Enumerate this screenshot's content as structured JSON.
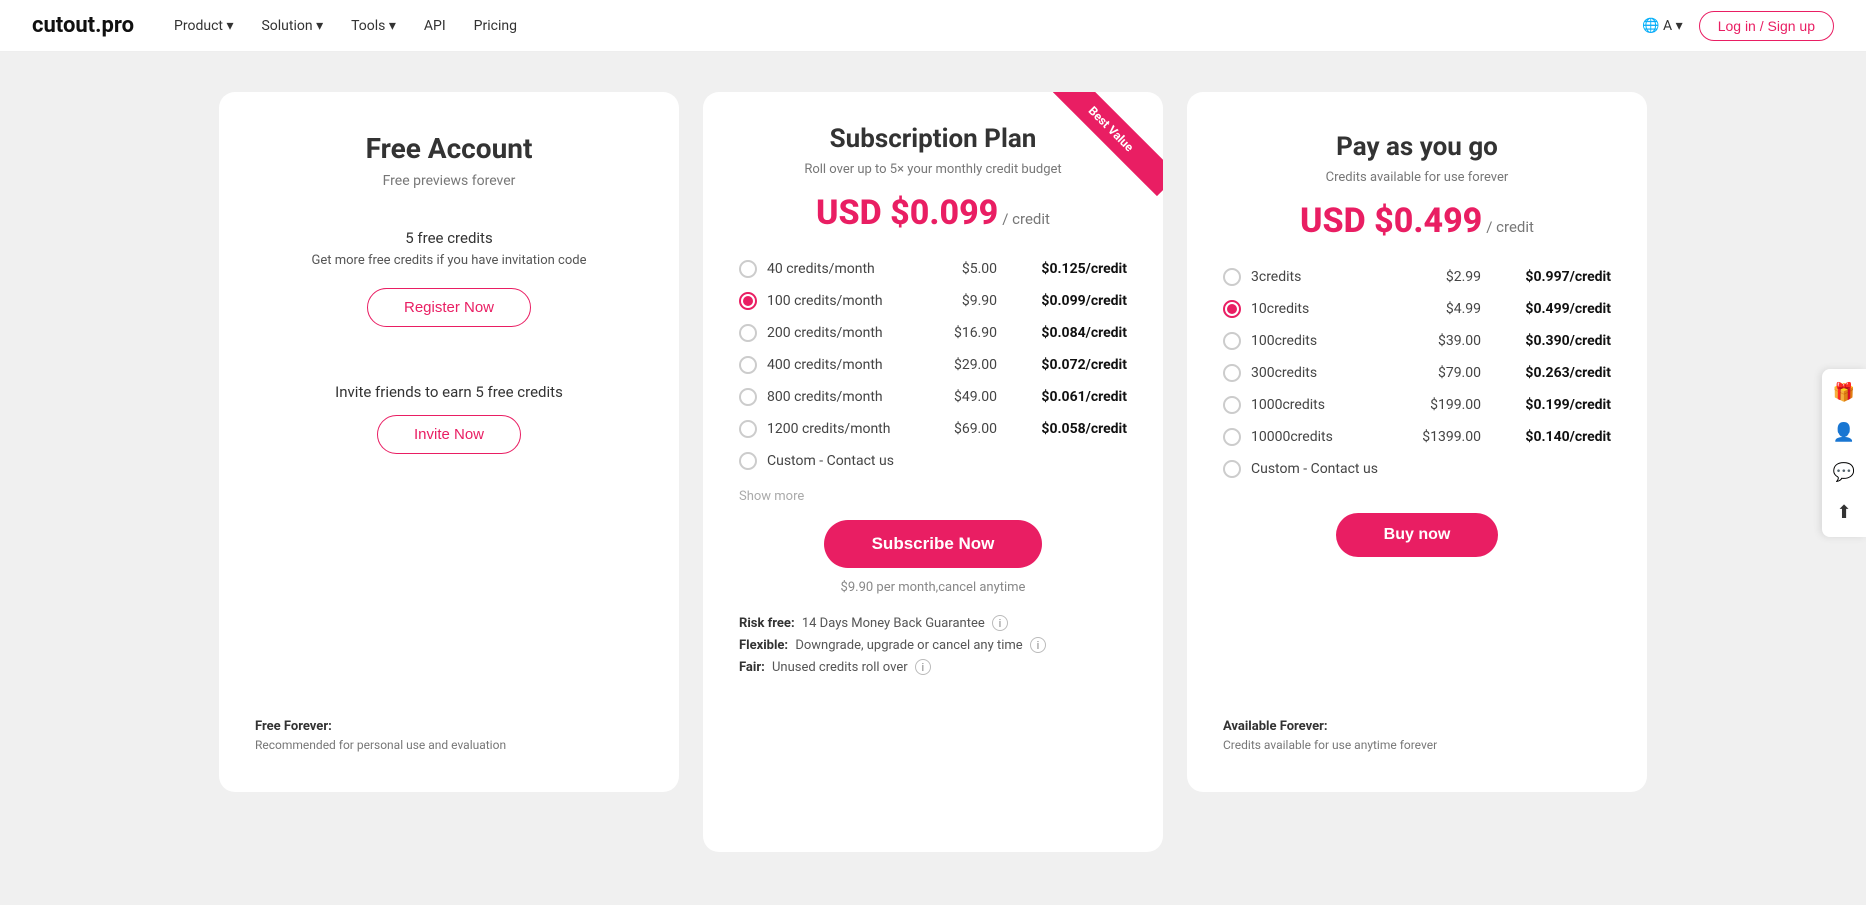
{
  "nav": {
    "logo": "cutout.pro",
    "links": [
      {
        "label": "Product",
        "hasArrow": true
      },
      {
        "label": "Solution",
        "hasArrow": true
      },
      {
        "label": "Tools",
        "hasArrow": true
      },
      {
        "label": "API",
        "hasArrow": false
      },
      {
        "label": "Pricing",
        "hasArrow": false
      }
    ],
    "lang_icon": "🌐",
    "lang_label": "A",
    "login_label": "Log in / Sign up"
  },
  "free_card": {
    "title": "Free Account",
    "subtitle": "Free previews forever",
    "credits_text": "5 free credits",
    "invite_desc": "Get more free credits if you have invitation code",
    "register_btn": "Register Now",
    "invite_section_text": "Invite friends to earn 5 free credits",
    "invite_btn": "Invite Now",
    "footer_title": "Free Forever:",
    "footer_desc": "Recommended for personal use and evaluation"
  },
  "subscription_card": {
    "title": "Subscription Plan",
    "subtitle": "Roll over up to 5× your monthly credit budget",
    "ribbon": "Best Value",
    "price": "USD $0.099",
    "price_unit": "/ credit",
    "options": [
      {
        "label": "40 credits/month",
        "price": "$5.00",
        "per_credit": "$0.125/credit",
        "selected": false
      },
      {
        "label": "100 credits/month",
        "price": "$9.90",
        "per_credit": "$0.099/credit",
        "selected": true
      },
      {
        "label": "200 credits/month",
        "price": "$16.90",
        "per_credit": "$0.084/credit",
        "selected": false
      },
      {
        "label": "400 credits/month",
        "price": "$29.00",
        "per_credit": "$0.072/credit",
        "selected": false
      },
      {
        "label": "800 credits/month",
        "price": "$49.00",
        "per_credit": "$0.061/credit",
        "selected": false
      },
      {
        "label": "1200 credits/month",
        "price": "$69.00",
        "per_credit": "$0.058/credit",
        "selected": false
      },
      {
        "label": "Custom - Contact us",
        "price": "",
        "per_credit": "",
        "selected": false
      }
    ],
    "show_more": "Show more",
    "subscribe_btn": "Subscribe Now",
    "price_note": "$9.90 per month,cancel anytime",
    "features": [
      {
        "prefix": "Risk free:",
        "text": "14 Days Money Back Guarantee",
        "info": true
      },
      {
        "prefix": "Flexible:",
        "text": "Downgrade, upgrade or cancel any time",
        "info": true
      },
      {
        "prefix": "Fair:",
        "text": "Unused credits roll over",
        "info": true
      }
    ]
  },
  "payg_card": {
    "title": "Pay as you go",
    "subtitle": "Credits available for use forever",
    "price": "USD $0.499",
    "price_unit": "/ credit",
    "options": [
      {
        "label": "3credits",
        "price": "$2.99",
        "per_credit": "$0.997/credit",
        "selected": false
      },
      {
        "label": "10credits",
        "price": "$4.99",
        "per_credit": "$0.499/credit",
        "selected": true
      },
      {
        "label": "100credits",
        "price": "$39.00",
        "per_credit": "$0.390/credit",
        "selected": false
      },
      {
        "label": "300credits",
        "price": "$79.00",
        "per_credit": "$0.263/credit",
        "selected": false
      },
      {
        "label": "1000credits",
        "price": "$199.00",
        "per_credit": "$0.199/credit",
        "selected": false
      },
      {
        "label": "10000credits",
        "price": "$1399.00",
        "per_credit": "$0.140/credit",
        "selected": false
      },
      {
        "label": "Custom - Contact us",
        "price": "",
        "per_credit": "",
        "selected": false
      }
    ],
    "buy_btn": "Buy now",
    "footer_title": "Available Forever:",
    "footer_desc": "Credits available for use anytime forever"
  },
  "side_widgets": [
    {
      "icon": "🎁",
      "name": "gift"
    },
    {
      "icon": "👤",
      "name": "user"
    },
    {
      "icon": "💬",
      "name": "chat"
    },
    {
      "icon": "⬆",
      "name": "scroll-top"
    }
  ]
}
